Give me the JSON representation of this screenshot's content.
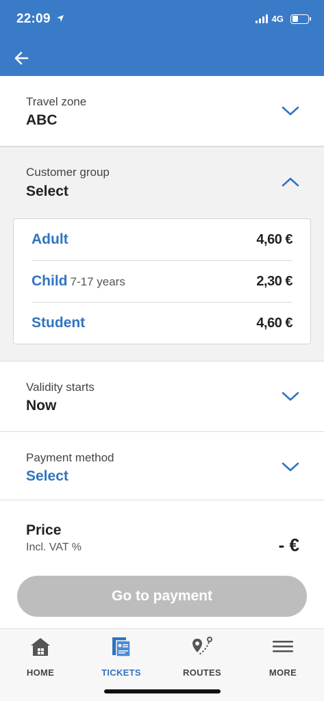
{
  "status_bar": {
    "time": "22:09",
    "network": "4G"
  },
  "travel_zone": {
    "label": "Travel zone",
    "value": "ABC"
  },
  "customer_group": {
    "label": "Customer group",
    "value": "Select",
    "options": [
      {
        "name": "Adult",
        "sub": "",
        "price": "4,60 €"
      },
      {
        "name": "Child",
        "sub": "7-17 years",
        "price": "2,30 €"
      },
      {
        "name": "Student",
        "sub": "",
        "price": "4,60 €"
      }
    ]
  },
  "validity": {
    "label": "Validity starts",
    "value": "Now"
  },
  "payment": {
    "label": "Payment method",
    "value": "Select"
  },
  "price": {
    "title": "Price",
    "subtitle": "Incl. VAT %",
    "value": "- €"
  },
  "actions": {
    "pay_label": "Go to payment"
  },
  "tabs": [
    {
      "label": "HOME",
      "icon": "home-icon"
    },
    {
      "label": "TICKETS",
      "icon": "tickets-icon"
    },
    {
      "label": "ROUTES",
      "icon": "routes-icon"
    },
    {
      "label": "MORE",
      "icon": "menu-icon"
    }
  ],
  "colors": {
    "brand": "#3a7bc8",
    "accent": "#2f74c0",
    "disabled": "#bdbdbd"
  }
}
